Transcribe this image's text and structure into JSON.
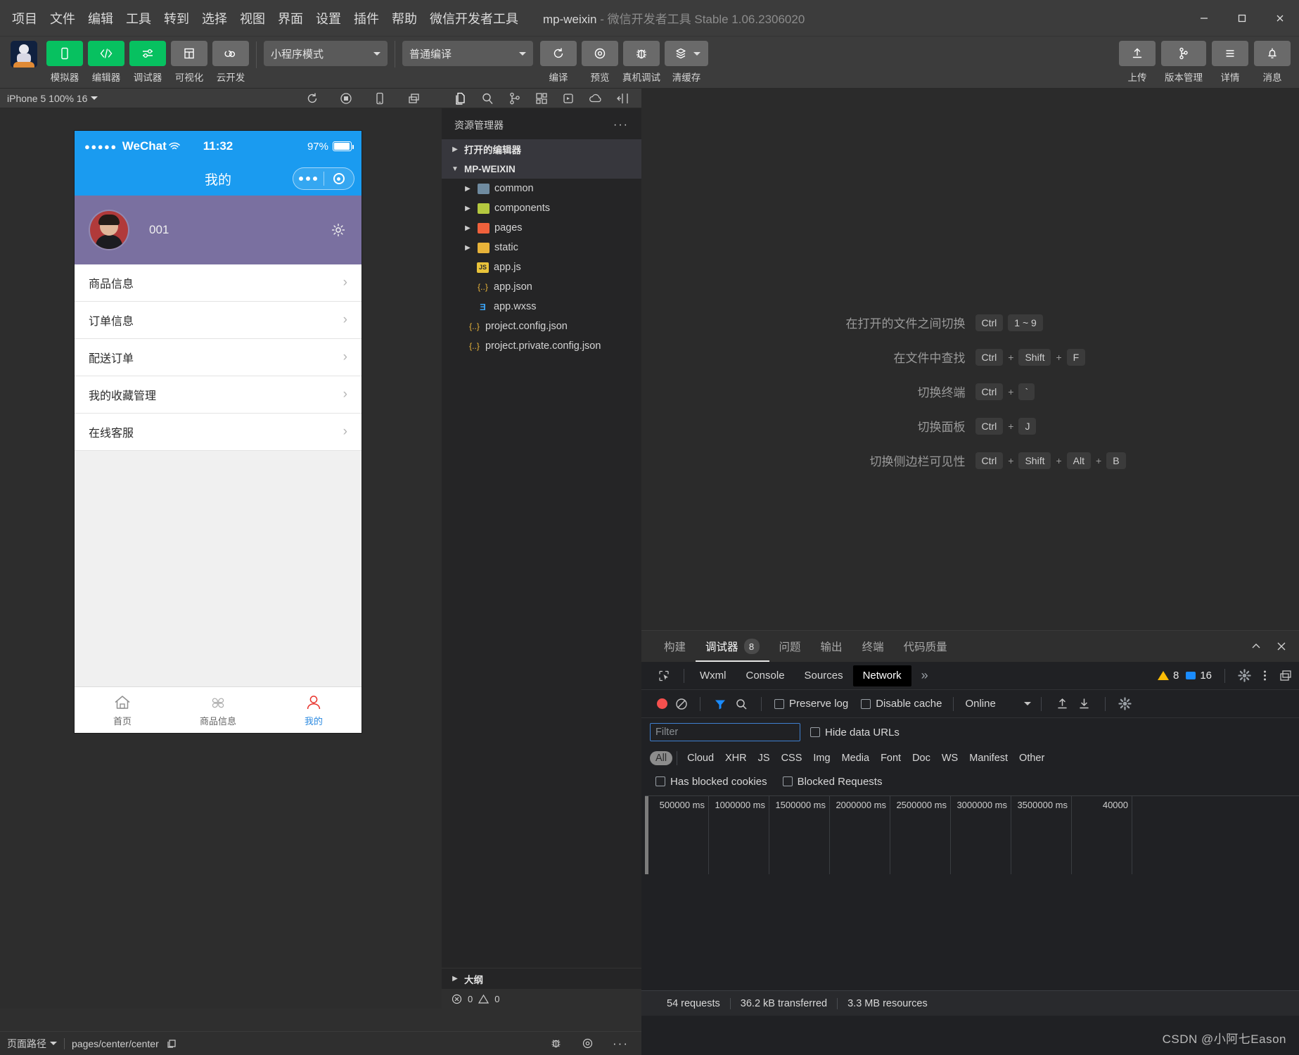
{
  "titlebar": {
    "menus": [
      "项目",
      "文件",
      "编辑",
      "工具",
      "转到",
      "选择",
      "视图",
      "界面",
      "设置",
      "插件",
      "帮助",
      "微信开发者工具"
    ],
    "project_name": "mp-weixin",
    "app_subtitle": "- 微信开发者工具 Stable 1.06.2306020",
    "window_minimize": "–",
    "window_maximize": "☐",
    "window_close": "✕"
  },
  "toolbar": {
    "left_buttons": [
      {
        "label": "模拟器",
        "icon": "phone-icon",
        "style": "green"
      },
      {
        "label": "编辑器",
        "icon": "code-icon",
        "style": "green"
      },
      {
        "label": "调试器",
        "icon": "sliders-icon",
        "style": "green"
      },
      {
        "label": "可视化",
        "icon": "layout-icon",
        "style": "grey"
      },
      {
        "label": "云开发",
        "icon": "cloud-icon",
        "style": "grey"
      }
    ],
    "mode_select": "小程序模式",
    "compile_select": "普通编译",
    "mid_buttons": [
      {
        "label": "编译",
        "icon": "refresh-icon"
      },
      {
        "label": "预览",
        "icon": "eye-icon"
      },
      {
        "label": "真机调试",
        "icon": "bug-icon"
      },
      {
        "label": "清缓存",
        "icon": "layers-icon"
      }
    ],
    "right_buttons": [
      {
        "label": "上传",
        "icon": "upload-icon"
      },
      {
        "label": "版本管理",
        "icon": "branch-icon"
      },
      {
        "label": "详情",
        "icon": "menu-icon"
      },
      {
        "label": "消息",
        "icon": "bell-icon"
      }
    ]
  },
  "simulator": {
    "device_label": "iPhone 5 100% 16",
    "toolbar_icons": [
      "refresh-icon",
      "record-icon",
      "rotate-icon",
      "window-icon"
    ],
    "phone": {
      "status": {
        "dots": "●●●●●",
        "carrier": "WeChat",
        "time": "11:32",
        "battery": "97%"
      },
      "nav_title": "我的",
      "profile": {
        "name": "001",
        "gear": "gear-icon"
      },
      "menu_items": [
        "商品信息",
        "订单信息",
        "配送订单",
        "我的收藏管理",
        "在线客服"
      ],
      "tabbar": [
        {
          "label": "首页",
          "icon": "home-icon",
          "active": false
        },
        {
          "label": "商品信息",
          "icon": "grid-icon",
          "active": false
        },
        {
          "label": "我的",
          "icon": "user-icon",
          "active": true
        }
      ]
    }
  },
  "explorer": {
    "activity_icons": [
      "files-icon",
      "search-icon",
      "source-control-icon",
      "extensions-icon",
      "debug-icon",
      "cloud-icon",
      "split-icon"
    ],
    "title": "资源管理器",
    "more": "···",
    "sections": [
      {
        "label": "打开的编辑器",
        "expanded": false
      },
      {
        "label": "MP-WEIXIN",
        "expanded": true
      }
    ],
    "tree": [
      {
        "name": "common",
        "type": "folder",
        "color": "#6f8ba0",
        "expandable": true
      },
      {
        "name": "components",
        "type": "folder",
        "color": "#b5c93f",
        "expandable": true
      },
      {
        "name": "pages",
        "type": "folder",
        "color": "#f0613c",
        "expandable": true
      },
      {
        "name": "static",
        "type": "folder",
        "color": "#e8b339",
        "expandable": true
      },
      {
        "name": "app.js",
        "type": "js",
        "color": "#e9c33a",
        "expandable": false
      },
      {
        "name": "app.json",
        "type": "json",
        "color": "#e8b339",
        "expandable": false
      },
      {
        "name": "app.wxss",
        "type": "wxss",
        "color": "#3aa0f0",
        "expandable": false
      },
      {
        "name": "project.config.json",
        "type": "json",
        "color": "#e8b339",
        "expandable": false
      },
      {
        "name": "project.private.config.json",
        "type": "json",
        "color": "#e8b339",
        "expandable": false
      }
    ],
    "outline": "大纲",
    "errors": "0",
    "warnings": "0"
  },
  "shortcuts": [
    {
      "label": "在打开的文件之间切换",
      "keys": [
        "Ctrl",
        "1 ~ 9"
      ],
      "seps": [
        ""
      ]
    },
    {
      "label": "在文件中查找",
      "keys": [
        "Ctrl",
        "Shift",
        "F"
      ],
      "seps": [
        "+",
        "+"
      ]
    },
    {
      "label": "切换终端",
      "keys": [
        "Ctrl",
        "`"
      ],
      "seps": [
        "+"
      ]
    },
    {
      "label": "切换面板",
      "keys": [
        "Ctrl",
        "J"
      ],
      "seps": [
        "+"
      ]
    },
    {
      "label": "切换侧边栏可见性",
      "keys": [
        "Ctrl",
        "Shift",
        "Alt",
        "B"
      ],
      "seps": [
        "+",
        "+",
        "+"
      ]
    }
  ],
  "devtools": {
    "panel_tabs": [
      {
        "label": "构建",
        "active": false,
        "badge": null
      },
      {
        "label": "调试器",
        "active": true,
        "badge": "8"
      },
      {
        "label": "问题",
        "active": false,
        "badge": null
      },
      {
        "label": "输出",
        "active": false,
        "badge": null
      },
      {
        "label": "终端",
        "active": false,
        "badge": null
      },
      {
        "label": "代码质量",
        "active": false,
        "badge": null
      }
    ],
    "panel_collapse_icon": "chevron-up-icon",
    "panel_close_icon": "close-icon",
    "sub_tabs": [
      {
        "label": "Wxml",
        "active": false
      },
      {
        "label": "Console",
        "active": false
      },
      {
        "label": "Sources",
        "active": false
      },
      {
        "label": "Network",
        "active": true
      }
    ],
    "more_tabs": "»",
    "warning_count": "8",
    "message_count": "16",
    "network_toolbar": {
      "preserve_log": "Preserve log",
      "disable_cache": "Disable cache",
      "throttling": "Online"
    },
    "filter_placeholder": "Filter",
    "hide_data_urls": "Hide data URLs",
    "types": [
      "All",
      "Cloud",
      "XHR",
      "JS",
      "CSS",
      "Img",
      "Media",
      "Font",
      "Doc",
      "WS",
      "Manifest",
      "Other"
    ],
    "active_type": "All",
    "has_blocked_cookies": "Has blocked cookies",
    "blocked_requests": "Blocked Requests",
    "timeline_ticks": [
      "500000 ms",
      "1000000 ms",
      "1500000 ms",
      "2000000 ms",
      "2500000 ms",
      "3000000 ms",
      "3500000 ms",
      "40000"
    ],
    "summary": [
      "54 requests",
      "36.2 kB transferred",
      "3.3 MB resources"
    ]
  },
  "statusbar": {
    "page_path_label": "页面路径",
    "page_path": "pages/center/center",
    "copy_icon": "copy-icon",
    "right_icons": [
      "bug-icon",
      "eye-icon",
      "more-icon"
    ]
  },
  "watermark": "CSDN @小阿七Eason",
  "colors": {
    "accent_green": "#07c160",
    "wechat_blue": "#1a9bf0",
    "hero_purple": "#7a70a0",
    "tab_active": "#2c8ae0"
  }
}
